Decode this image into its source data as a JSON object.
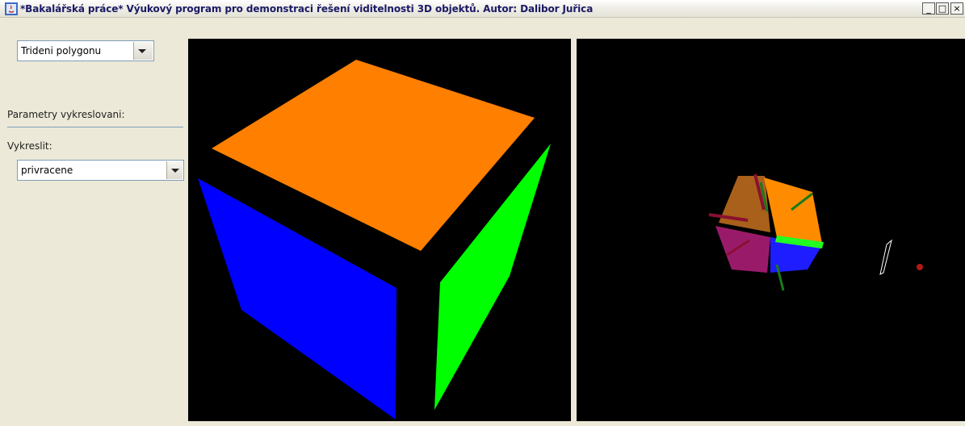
{
  "window": {
    "title": "*Bakalářská práce* Výukový program pro demonstraci řešení viditelnosti 3D objektů. Autor: Dalibor Juřica",
    "controls": {
      "minimize": "_",
      "maximize": "□",
      "close": "×"
    }
  },
  "left_panel": {
    "algorithm_select": {
      "value": "Trideni polygonu"
    },
    "section_heading": "Parametry vykreslovani:",
    "draw_label": "Vykreslit:",
    "draw_select": {
      "value": "privracene"
    }
  },
  "colors": {
    "top_face": "#ff7f00",
    "left_face": "#0000ff",
    "right_face": "#00ff00",
    "viewport_bg": "#000000",
    "window_bg": "#ece9d8"
  }
}
